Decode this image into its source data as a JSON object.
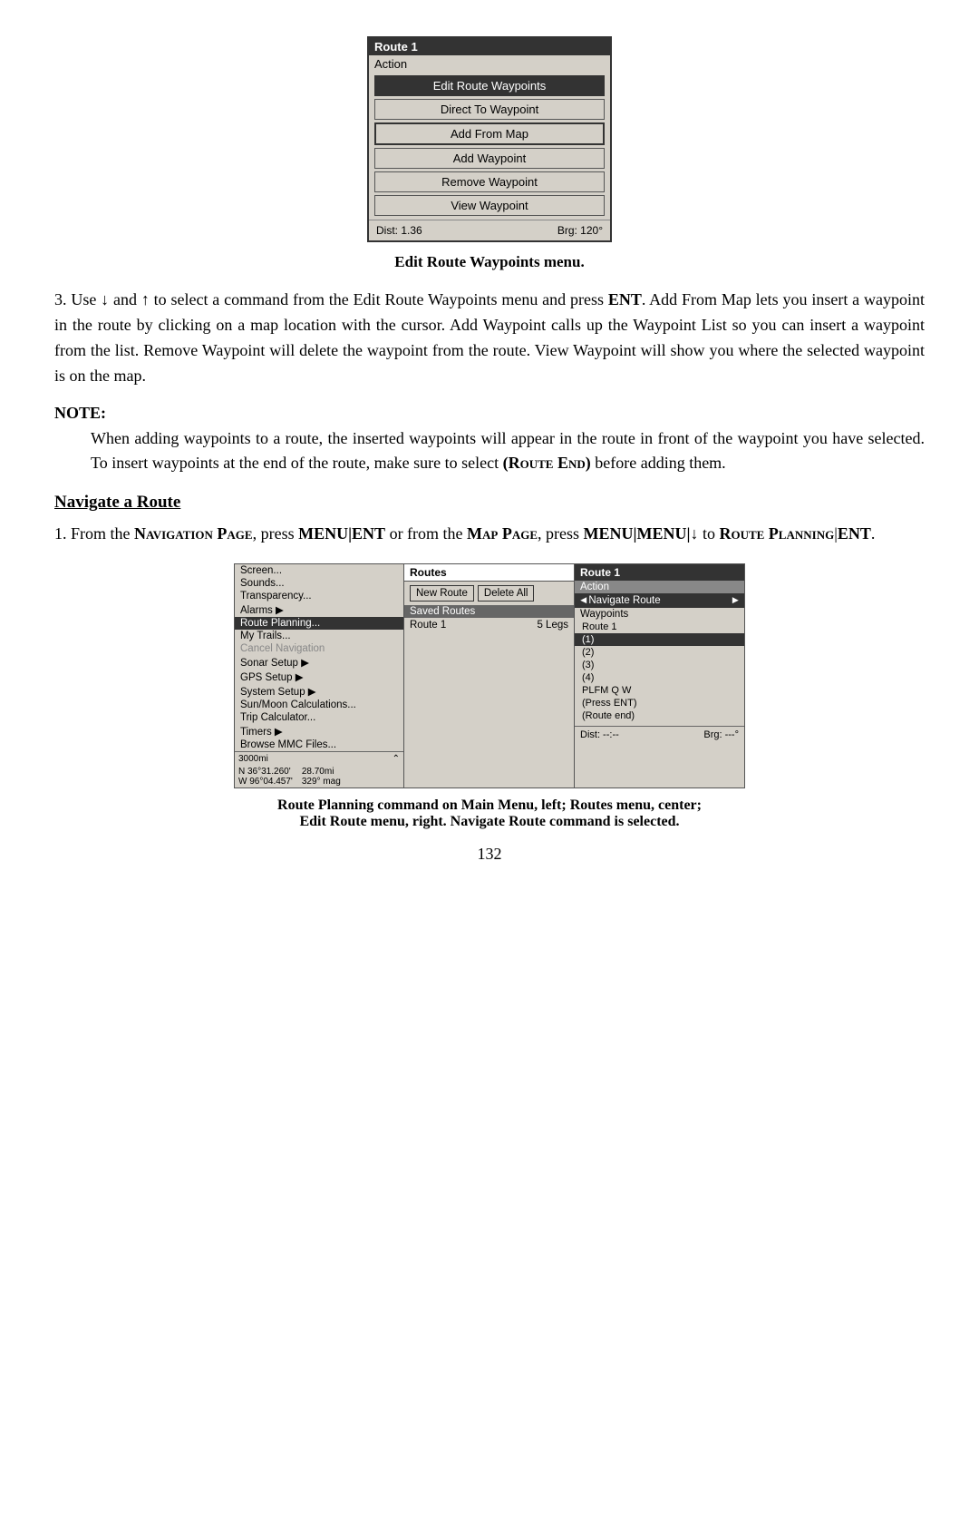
{
  "top_device": {
    "title": "Route 1",
    "action_label": "Action",
    "buttons": [
      {
        "label": "Edit Route Waypoints",
        "style": "highlighted"
      },
      {
        "label": "Direct To Waypoint",
        "style": "normal"
      },
      {
        "label": "Add From Map",
        "style": "outlined"
      },
      {
        "label": "Add Waypoint",
        "style": "normal"
      },
      {
        "label": "Remove Waypoint",
        "style": "normal"
      },
      {
        "label": "View Waypoint",
        "style": "normal"
      }
    ],
    "dist": "Dist: 1.36",
    "brg": "Brg: 120°"
  },
  "top_caption": "Edit Route Waypoints menu.",
  "paragraph1": "3. Use ↓ and ↑ to select a command from the Edit Route Waypoints menu and press ENT. Add From Map lets you insert a waypoint in the route by clicking on a map location with the cursor. Add Waypoint calls up the Waypoint List so you can insert a waypoint from the list. Remove Waypoint will delete the waypoint from the route. View Waypoint will show you where the selected waypoint is on the map.",
  "note_title": "NOTE:",
  "note_body": "When adding waypoints to a route, the inserted waypoints will appear in the route in front of the waypoint you have selected. To insert waypoints at the end of the route, make sure to select (Route End) before adding them.",
  "section_heading": "Navigate a Route",
  "paragraph2_part1": "1. From the ",
  "paragraph2_nav": "Navigation Page",
  "paragraph2_part2": ", press ",
  "paragraph2_menu": "MENU|ENT",
  "paragraph2_part3": " or from the ",
  "paragraph2_map": "Map Page",
  "paragraph2_part4": ", press ",
  "paragraph2_menu2": "MENU|MENU|↓",
  "paragraph2_part5": " to ",
  "paragraph2_route": "Route Planning|ENT",
  "paragraph2_end": ".",
  "left_panel": {
    "items": [
      {
        "label": "Screen...",
        "style": "normal"
      },
      {
        "label": "Sounds...",
        "style": "normal"
      },
      {
        "label": "Transparency...",
        "style": "normal"
      },
      {
        "label": "Alarms",
        "style": "arrow"
      },
      {
        "label": "Route Planning...",
        "style": "highlighted"
      },
      {
        "label": "My Trails...",
        "style": "normal"
      },
      {
        "label": "Cancel Navigation",
        "style": "greyed"
      },
      {
        "label": "Sonar Setup",
        "style": "arrow"
      },
      {
        "label": "GPS Setup",
        "style": "arrow"
      },
      {
        "label": "System Setup",
        "style": "arrow"
      },
      {
        "label": "Sun/Moon Calculations...",
        "style": "normal"
      },
      {
        "label": "Trip Calculator...",
        "style": "normal"
      },
      {
        "label": "Timers",
        "style": "arrow"
      },
      {
        "label": "Browse MMC Files...",
        "style": "normal"
      }
    ],
    "scale": "3000mi",
    "coord_n": "N  36°31.260'",
    "coord_dist": "28.70mi",
    "coord_w": "W  96°04.457'",
    "coord_mag": "329° mag"
  },
  "center_panel": {
    "title": "Routes",
    "btn_new": "New Route",
    "btn_delete": "Delete All",
    "saved_label": "Saved Routes",
    "route_name": "Route 1",
    "route_legs": "5 Legs"
  },
  "right_panel": {
    "title": "Route 1",
    "action_label": "Action",
    "navigate_label": "◄Navigate Route",
    "navigate_arrow": "►",
    "waypoints_label": "Waypoints",
    "waypoint_items": [
      {
        "label": "Route 1",
        "style": "normal"
      },
      {
        "label": "(1)",
        "style": "highlighted"
      },
      {
        "label": "(2)",
        "style": "normal"
      },
      {
        "label": "(3)",
        "style": "normal"
      },
      {
        "label": "(4)",
        "style": "normal"
      },
      {
        "label": "PLFM Q W",
        "style": "normal"
      },
      {
        "label": "(Press ENT)",
        "style": "normal"
      },
      {
        "label": "(Route end)",
        "style": "normal"
      }
    ],
    "dist": "Dist: --:--",
    "brg": "Brg: ---°"
  },
  "bottom_caption_line1": "Route Planning command on Main Menu, left; Routes  menu, center;",
  "bottom_caption_line2": "Edit Route menu, right. Navigate Route command is selected.",
  "page_number": "132"
}
